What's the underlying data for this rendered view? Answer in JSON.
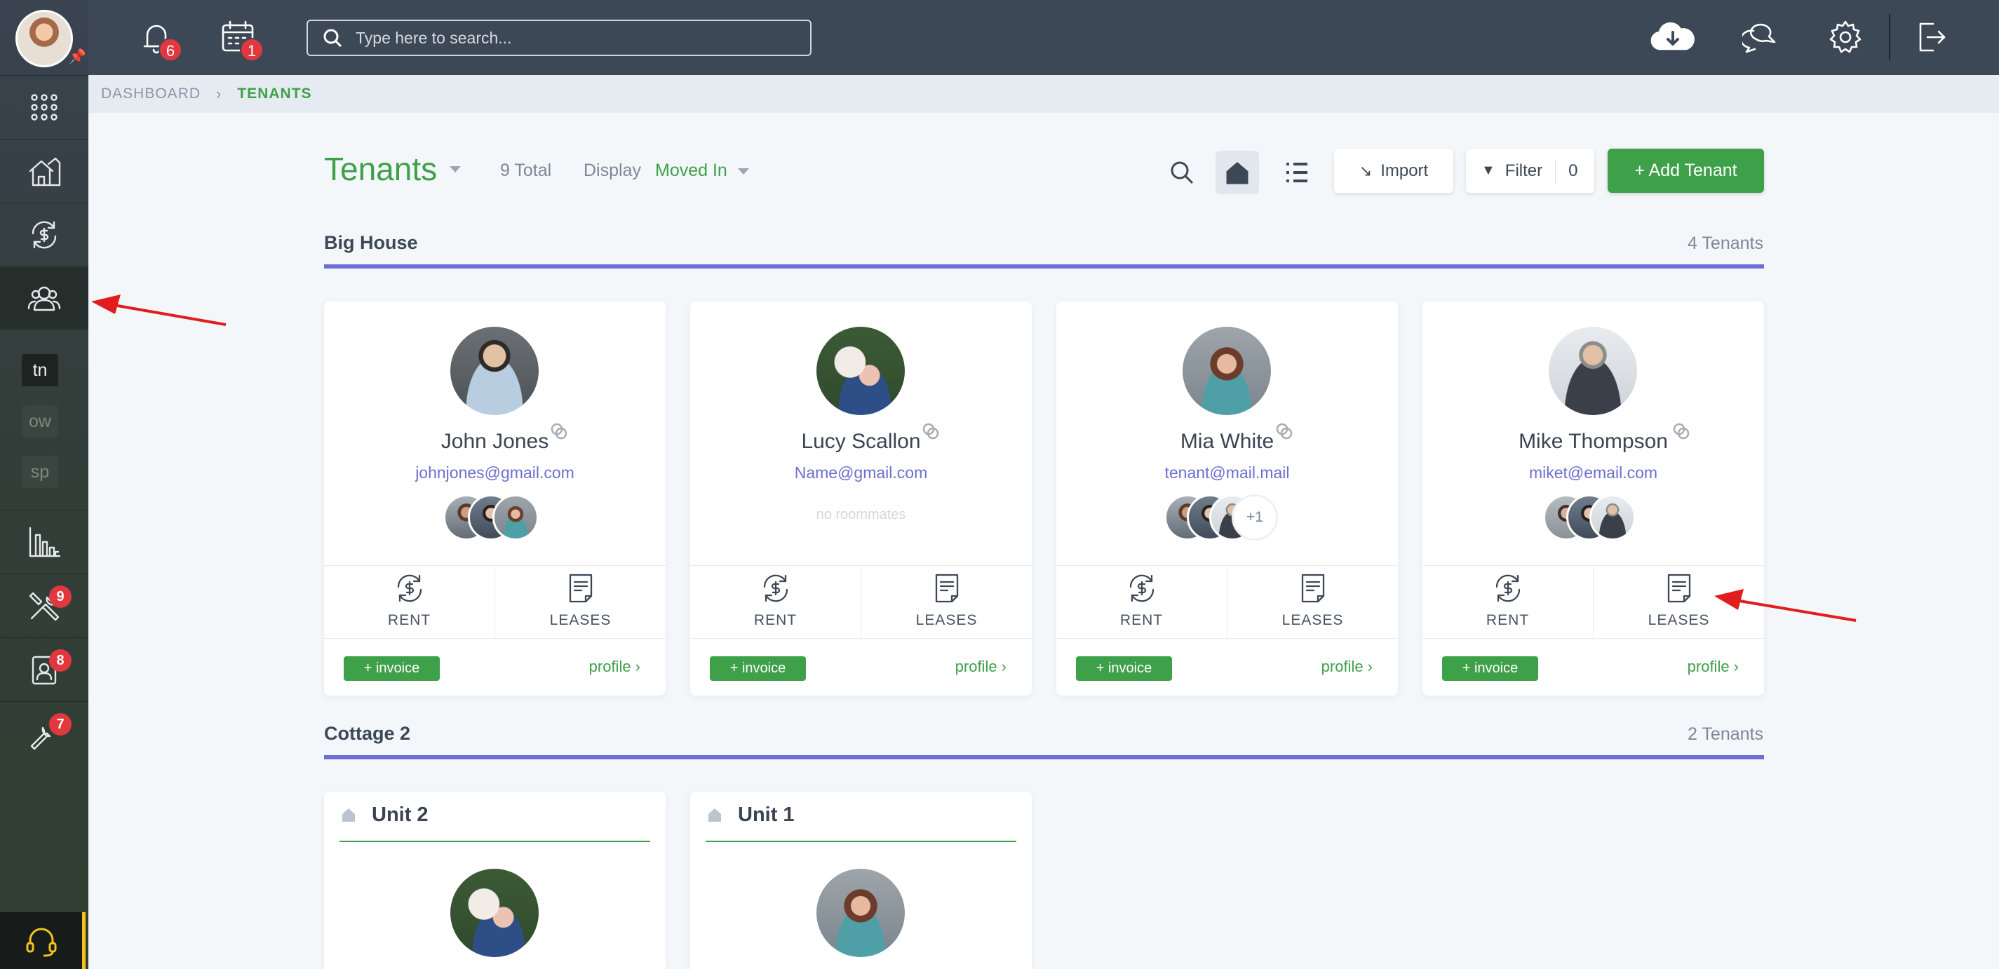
{
  "topbar": {
    "notifications_count": "6",
    "calendar_count": "1",
    "search_placeholder": "Type here to search..."
  },
  "sidebar": {
    "accounts": [
      "tn",
      "ow",
      "sp"
    ],
    "maintenance_count": "9",
    "applicants_count": "8",
    "tools_count": "7"
  },
  "breadcrumb": {
    "dashboard": "DASHBOARD",
    "current": "TENANTS"
  },
  "header": {
    "title": "Tenants",
    "total": "9 Total",
    "display_label": "Display",
    "display_value": "Moved In",
    "import_label": "Import",
    "filter_label": "Filter",
    "filter_count": "0",
    "add_label": "+ Add Tenant"
  },
  "sections": [
    {
      "title": "Big House",
      "count": "4 Tenants",
      "tenants": [
        {
          "name": "John Jones",
          "email": "johnjones@gmail.com",
          "roommates_extra": ""
        },
        {
          "name": "Lucy Scallon",
          "email": "Name@gmail.com",
          "no_roommates": "no roommates"
        },
        {
          "name": "Mia White",
          "email": "tenant@mail.mail",
          "roommates_extra": "+1"
        },
        {
          "name": "Mike Thompson",
          "email": "miket@email.com",
          "roommates_extra": ""
        }
      ]
    },
    {
      "title": "Cottage 2",
      "count": "2 Tenants",
      "units": [
        {
          "title": "Unit 2"
        },
        {
          "title": "Unit 1"
        }
      ]
    }
  ],
  "card_labels": {
    "rent": "RENT",
    "leases": "LEASES",
    "invoice": "+ invoice",
    "profile": "profile ›"
  },
  "colors": {
    "accent_green": "#3ea049",
    "section_line": "#6c70d6",
    "badge_red": "#e0383e",
    "topbar": "#3d4856",
    "arrow_red": "#e11d1d"
  }
}
